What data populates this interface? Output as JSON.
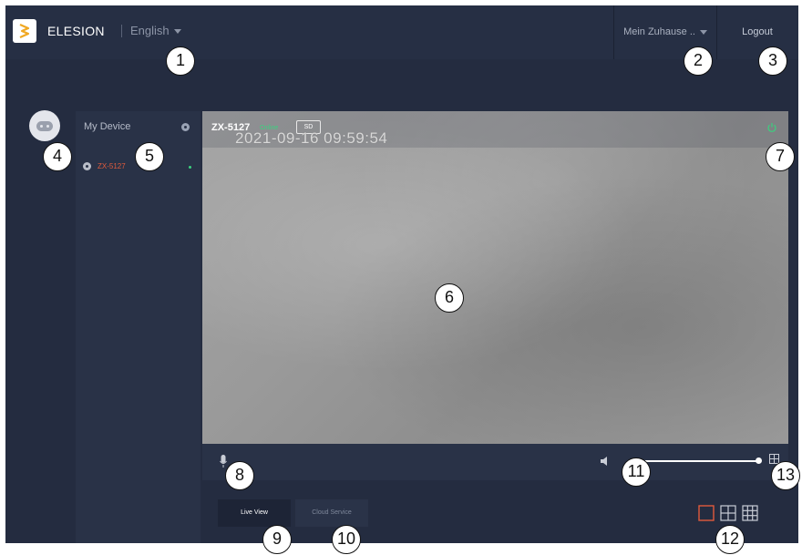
{
  "topbar": {
    "brand": "ELESION",
    "language": "English",
    "home": "Mein Zuhause ..",
    "logout": "Logout"
  },
  "sidebar": {
    "title": "My Device",
    "devices": [
      {
        "name": "ZX-5127",
        "status_color": "#3bd17f"
      }
    ]
  },
  "video": {
    "camera_name": "ZX-5127",
    "status": "Online",
    "quality": "SD",
    "timestamp": "2021-09-16 09:59:54"
  },
  "tabs": [
    {
      "label": "Live View",
      "active": true
    },
    {
      "label": "Cloud Service",
      "active": false
    }
  ],
  "controls": {
    "volume_level": 1.0
  },
  "view_layouts": [
    "single-view",
    "quad-view",
    "nine-view"
  ],
  "annotations": [
    "1",
    "2",
    "3",
    "4",
    "5",
    "6",
    "7",
    "8",
    "9",
    "10",
    "11",
    "12",
    "13"
  ],
  "colors": {
    "background": "#242c40",
    "accent": "#e05b3c",
    "online": "#3bd17f"
  }
}
